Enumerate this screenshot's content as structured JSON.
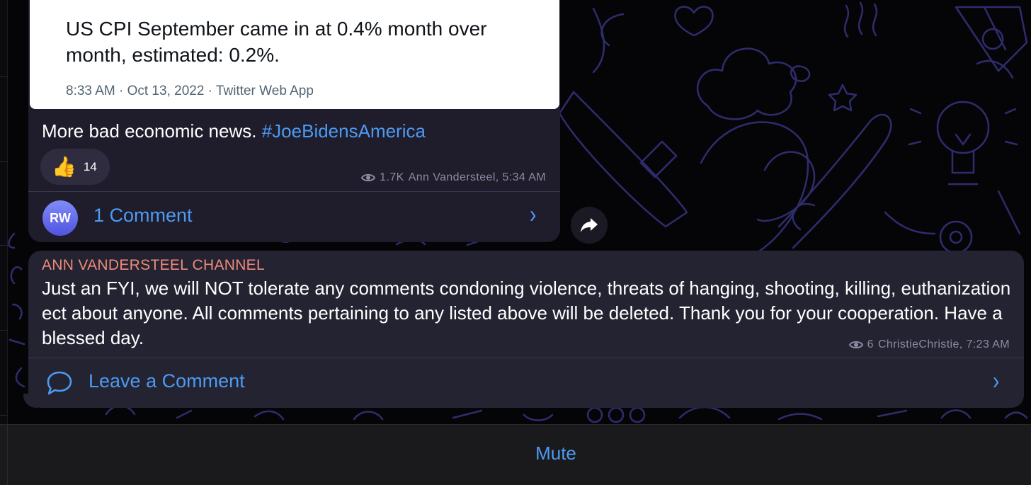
{
  "tweet": {
    "text": "US CPI September came in at 0.4% month over month, estimated: 0.2%.",
    "meta": "8:33 AM · Oct 13, 2022 · Twitter Web App"
  },
  "post1": {
    "caption": "More bad economic news.",
    "hashtag": "#JoeBidensAmerica",
    "reaction_count": "14",
    "views": "1.7K",
    "author_time": "Ann Vandersteel, 5:34 AM",
    "avatar_initials": "RW",
    "comments_label": "1 Comment"
  },
  "post2": {
    "channel": "ANN VANDERSTEEL CHANNEL",
    "text": "Just an FYI, we will NOT tolerate any comments condoning violence, threats of hanging, shooting, killing, euthanization ect about anyone. All comments pertaining to any listed above will be deleted. Thank you for your cooperation. Have a blessed day.",
    "views": "6",
    "author_time": "ChristieChristie, 7:23 AM",
    "leave_comment_label": "Leave a Comment"
  },
  "bottom_bar": {
    "mute_label": "Mute"
  },
  "icons": {
    "views": "eye-icon",
    "reaction": "thumbs-up-icon",
    "forward": "share-arrow-icon",
    "comment": "speech-bubble-icon",
    "chevron": "chevron-right-icon"
  },
  "colors": {
    "accent": "#4c9bf2",
    "channel_name": "#f08a7a",
    "bubble": "#242332",
    "background": "#050507"
  }
}
